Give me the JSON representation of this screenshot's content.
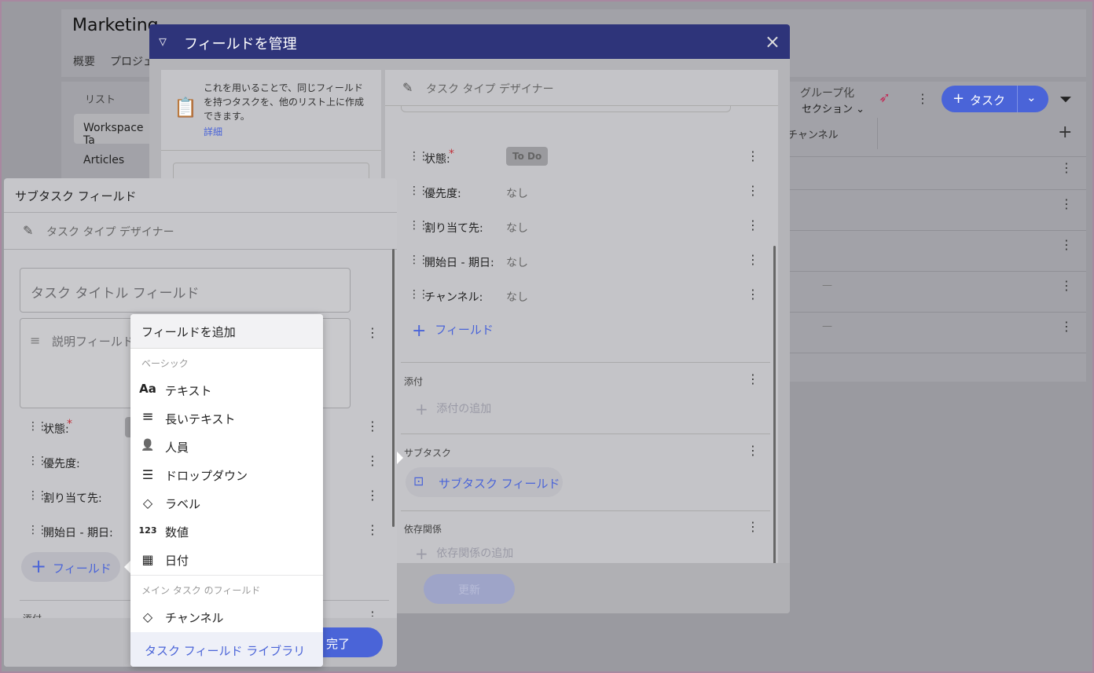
{
  "background": {
    "title": "Marketing",
    "tabs": [
      "概要",
      "プロジェ"
    ],
    "sidebar_header": "リスト",
    "sidebar_items": [
      "Workspace Ta",
      "Articles"
    ],
    "group_label": "グループ化",
    "group_value": "セクション",
    "task_button": "タスク",
    "column_channel": "チャンネル",
    "dash": "—"
  },
  "manage_modal": {
    "title": "フィールドを管理",
    "info_text": "これを用いることで、同じフィールドを持つタスクを、他のリスト上に作成できます。",
    "info_link": "詳細",
    "designer_label": "タスク タイプ デザイナー",
    "fields": [
      {
        "label": "状態:",
        "required": true,
        "value": "To Do"
      },
      {
        "label": "優先度:",
        "value": "なし"
      },
      {
        "label": "割り当て先:",
        "value": "なし"
      },
      {
        "label": "開始日 - 期日:",
        "value": "なし"
      },
      {
        "label": "チャンネル:",
        "value": "なし"
      }
    ],
    "add_field": "フィールド",
    "attachments_label": "添付",
    "add_attachment": "添付の追加",
    "subtasks_label": "サブタスク",
    "subtask_field": "サブタスク フィールド",
    "dependencies_label": "依存関係",
    "add_dependency": "依存関係の追加",
    "update_button": "更新"
  },
  "subtask_panel": {
    "title": "サブタスク フィールド",
    "designer_label": "タスク タイプ デザイナー",
    "title_placeholder": "タスク タイトル フィールド",
    "desc_placeholder": "説明フィールド",
    "fields": [
      {
        "label": "状態:",
        "required": true
      },
      {
        "label": "優先度:"
      },
      {
        "label": "割り当て先:"
      },
      {
        "label": "開始日 - 期日:"
      }
    ],
    "add_field": "フィールド",
    "attachments_cut": "添付",
    "done_button": "完了"
  },
  "add_field_menu": {
    "title": "フィールドを追加",
    "basic_header": "ベーシック",
    "basic_items": [
      {
        "icon": "text-icon",
        "glyph": "Aa",
        "label": "テキスト"
      },
      {
        "icon": "long-text-icon",
        "glyph": "≡",
        "label": "長いテキスト"
      },
      {
        "icon": "person-icon",
        "glyph": "👤",
        "label": "人員"
      },
      {
        "icon": "dropdown-icon",
        "glyph": "☰",
        "label": "ドロップダウン"
      },
      {
        "icon": "tag-icon",
        "glyph": "◇",
        "label": "ラベル"
      },
      {
        "icon": "number-icon",
        "glyph": "123",
        "label": "数値"
      },
      {
        "icon": "calendar-icon",
        "glyph": "▦",
        "label": "日付"
      }
    ],
    "main_header": "メイン タスク のフィールド",
    "main_items": [
      {
        "icon": "tag-icon",
        "glyph": "◇",
        "label": "チャンネル"
      }
    ],
    "library_link": "タスク フィールド ライブラリ"
  }
}
